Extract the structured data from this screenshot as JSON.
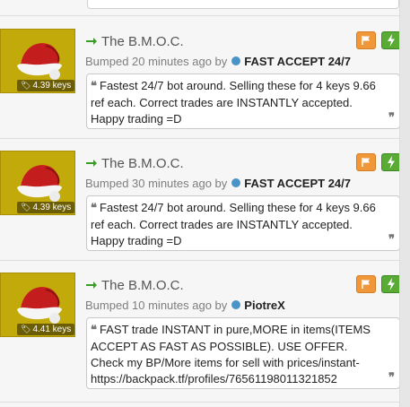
{
  "listings": [
    {
      "item_name": "The B.M.O.C.",
      "price": "4.39 keys",
      "bumped": "Bumped 20 minutes ago by",
      "user": "FAST ACCEPT 24/7",
      "comment": "Fastest 24/7 bot around. Selling these for 4 keys 9.66 ref each. Correct trades are INSTANTLY accepted. Happy trading =D"
    },
    {
      "item_name": "The B.M.O.C.",
      "price": "4.39 keys",
      "bumped": "Bumped 30 minutes ago by",
      "user": "FAST ACCEPT 24/7",
      "comment": "Fastest 24/7 bot around. Selling these for 4 keys 9.66 ref each. Correct trades are INSTANTLY accepted. Happy trading =D"
    },
    {
      "item_name": "The B.M.O.C.",
      "price": "4.41 keys",
      "bumped": "Bumped 10 minutes ago by",
      "user": "PiotreX",
      "comment": "FAST trade INSTANT in pure,MORE in items(ITEMS ACCEPT AS FAST AS POSSIBLE). USE OFFER. Check my BP/More items for sell with prices/instant- https://backpack.tf/profiles/76561198011321852"
    }
  ],
  "icons": {
    "title": "green-arrow-right",
    "flag": "flag",
    "bolt": "lightning-bolt",
    "price": "tag",
    "quote_open": "left-quote",
    "quote_close": "right-quote"
  },
  "colors": {
    "thumb_bg": "#c3aa0b",
    "flag_button": "#f0973a",
    "bolt_button": "#5aaa36",
    "arrow": "#3e9a2a",
    "status_dot": "#4b93c7"
  }
}
